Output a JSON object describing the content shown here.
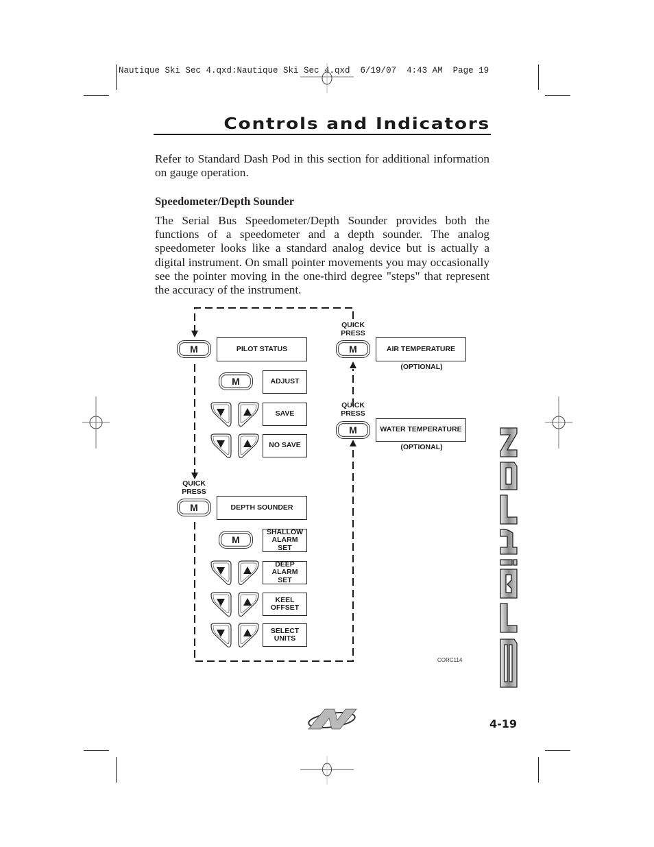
{
  "slug": "Nautique Ski Sec 4.qxd:Nautique Ski Sec 4.qxd  6/19/07  4:43 AM  Page 19",
  "header": {
    "title": "Controls and Indicators"
  },
  "intro": "Refer to Standard Dash Pod in this section for additional information on gauge operation.",
  "section": {
    "heading": "Speedometer/Depth Sounder",
    "body": "The Serial Bus Speedometer/Depth Sounder provides both the functions of a speedometer and a depth sounder. The analog speedometer looks like a standard analog device but is actually a digital instrument. On small pointer movements you may occasionally see the pointer moving in the one-third degree \"steps\" that represent the accuracy of the instrument."
  },
  "diagram": {
    "mode_button_label": "M",
    "quick_press": "QUICK PRESS",
    "left_column": {
      "pilot_status": "PILOT STATUS",
      "adjust": "ADJUST",
      "save": "SAVE",
      "no_save": "NO SAVE",
      "depth_sounder": "DEPTH SOUNDER",
      "shallow_alarm_set": "SHALLOW ALARM SET",
      "deep_alarm_set": "DEEP ALARM SET",
      "keel_offset": "KEEL OFFSET",
      "select_units": "SELECT UNITS"
    },
    "right_column": {
      "air_temperature": "AIR TEMPERATURE",
      "water_temperature": "WATER TEMPERATURE",
      "optional": "(OPTIONAL)"
    },
    "figure_code": "CORC114"
  },
  "side_brand": "NAUTIQUE",
  "footer": {
    "page_number": "4-19",
    "logo": "nautique-n-logo"
  }
}
